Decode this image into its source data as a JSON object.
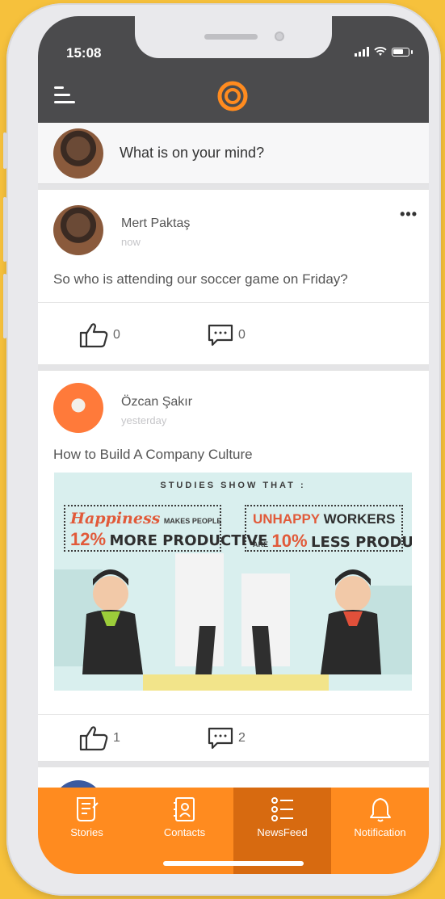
{
  "status_bar": {
    "time": "15:08",
    "signal_icon": "signal-icon",
    "wifi_icon": "wifi-icon",
    "battery_icon": "battery-icon"
  },
  "header": {
    "menu_icon": "menu-icon",
    "logo_icon": "app-logo-icon"
  },
  "composer": {
    "placeholder": "What is on your mind?"
  },
  "posts": [
    {
      "author": "Mert Paktaş",
      "time": "now",
      "text": "So who is attending our soccer game on Friday?",
      "likes": "0",
      "comments": "0"
    },
    {
      "author": "Özcan Şakır",
      "time": "yesterday",
      "text": "How to Build A Company Culture",
      "likes": "1",
      "comments": "2",
      "image": {
        "title": "STUDIES SHOW THAT :",
        "left_headline_a": "Happiness",
        "left_headline_b": "MAKES PEOPLE",
        "left_headline_c": "12%",
        "left_headline_d": "MORE PRODUCTIVE",
        "right_headline_a": "UNHAPPY",
        "right_headline_b": "WORKERS",
        "right_headline_c": "ARE",
        "right_headline_d": "10%",
        "right_headline_e": "LESS PRODUCTIVE"
      }
    }
  ],
  "tabbar": {
    "tabs": [
      {
        "label": "Stories",
        "icon": "stories-icon"
      },
      {
        "label": "Contacts",
        "icon": "contacts-icon"
      },
      {
        "label": "NewsFeed",
        "icon": "newsfeed-icon",
        "active": true
      },
      {
        "label": "Notification",
        "icon": "bell-icon"
      }
    ]
  },
  "colors": {
    "accent": "#ff8b1f",
    "accent_dark": "#d76a10",
    "header_bg": "#4b4b4d",
    "page_bg": "#f6c13c"
  }
}
